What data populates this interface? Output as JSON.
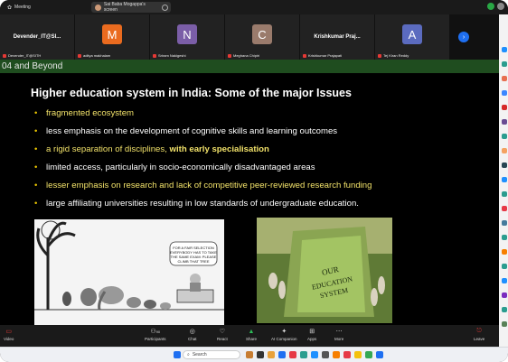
{
  "topbar": {
    "app_title": "Meeting",
    "share_title": "Sai Baba Mogappa's screen"
  },
  "gallery": {
    "tiles": [
      {
        "big": "Devender_IT@SI...",
        "label": "Devender_IT@SITH",
        "initial": "",
        "color": ""
      },
      {
        "big": "",
        "label": "aditya makhalam",
        "initial": "M",
        "color": "#ea6b1f"
      },
      {
        "big": "",
        "label": "Sriram Nakigeshi",
        "initial": "N",
        "color": "#7b5ea7"
      },
      {
        "big": "",
        "label": "Meghana Chipiri",
        "initial": "C",
        "color": "#9a7b6c"
      },
      {
        "big": "Krishkumar Praj...",
        "label": "Krishkumar Prajapati",
        "initial": "",
        "color": ""
      },
      {
        "big": "",
        "label": "Tej Kiran Reddy",
        "initial": "A",
        "color": "#5b6bbf"
      }
    ]
  },
  "slide": {
    "header": "04 and Beyond",
    "title": "Higher education system in India: Some of the major Issues",
    "bullets": [
      {
        "text": "fragmented ecosystem",
        "style": "c-y",
        "bold": ""
      },
      {
        "text": "less emphasis on the development of cognitive skills and learning outcomes",
        "style": "c-w",
        "bold": ""
      },
      {
        "text": "a rigid separation of disciplines, ",
        "style": "c-y",
        "bold": "with early specialisation"
      },
      {
        "text": "limited access, particularly in socio-economically disadvantaged areas",
        "style": "c-w",
        "bold": ""
      },
      {
        "text": "lesser emphasis on research and lack of competitive peer-reviewed research funding",
        "style": "c-y",
        "bold": ""
      },
      {
        "text": "large affiliating universities resulting in low standards of undergraduate education.",
        "style": "c-w",
        "bold": ""
      }
    ],
    "cartoon1_caption": "FOR A FAIR SELECTION EVERYBODY HAS TO TAKE THE SAME EXAM: PLEASE CLIMB THAT TREE",
    "cartoon2_caption": "OUR EDUCATION SYSTEM"
  },
  "controls": {
    "video": "Video",
    "participants": "Participants",
    "participants_count": "90",
    "chat": "Chat",
    "react": "React",
    "share": "Share",
    "ai_companion": "AI Companion",
    "apps": "Apps",
    "more": "More",
    "leave": "Leave"
  },
  "taskbar": {
    "search_placeholder": "Search"
  }
}
